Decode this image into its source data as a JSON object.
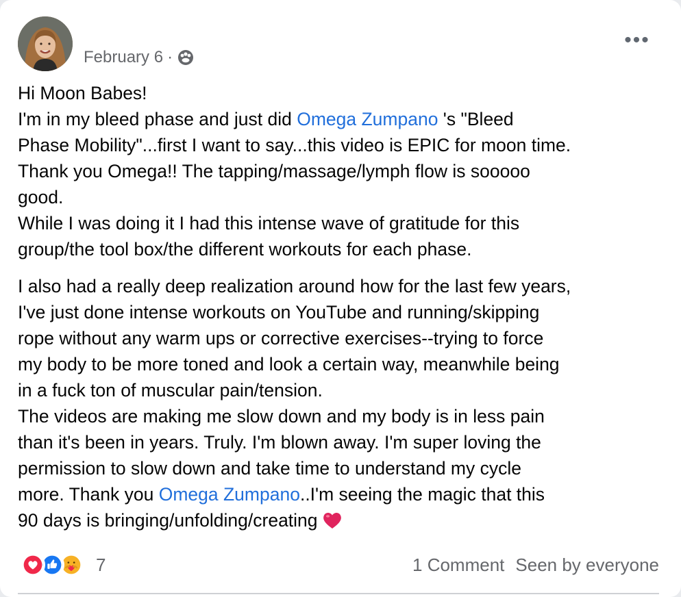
{
  "post": {
    "date": "February 6",
    "separator": "·",
    "audience_icon": "group-icon",
    "more_label": "•••",
    "paragraph1": [
      "Hi Moon Babes!",
      {
        "parts": [
          "I'm in my bleed phase and just did ",
          "Omega Zumpano",
          " 's \"Bleed"
        ]
      },
      "Phase Mobility\"...first I want to say...this video is EPIC for moon time.",
      "Thank you Omega!! The tapping/massage/lymph flow is sooooo",
      "good.",
      "While I was doing it I had this intense wave of gratitude for this",
      "group/the tool box/the different workouts for each phase."
    ],
    "paragraph2": [
      "I also had a really deep realization around how for the last few years,",
      "I've just done intense workouts on YouTube and running/skipping",
      "rope without any warm ups or corrective exercises--trying to force",
      "my body to be more toned and look a certain way, meanwhile being",
      "in a fuck ton of muscular pain/tension.",
      "The videos are making me slow down and my body is in less pain",
      "than it's been in years. Truly. I'm blown away. I'm super loving the",
      "permission to slow down and take time to understand my cycle",
      {
        "parts": [
          "more. Thank you ",
          "Omega Zumpano",
          "..I'm seeing the magic that this"
        ]
      },
      "90 days is bringing/unfolding/creating"
    ],
    "mention_name": "Omega Zumpano",
    "end_emoji": "red-heart-icon"
  },
  "footer": {
    "reactions": [
      "love-reaction-icon",
      "like-reaction-icon",
      "care-reaction-icon"
    ],
    "reaction_count": "7",
    "comment_count": "1 Comment",
    "seen_by": "Seen by everyone"
  },
  "colors": {
    "link": "#216fdb",
    "text": "#050505",
    "meta": "#65676b",
    "love": "#f0284a",
    "like": "#1877f2",
    "care": "#f7b125"
  }
}
